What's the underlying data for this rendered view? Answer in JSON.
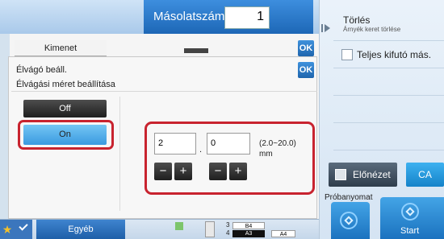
{
  "header": {
    "copies_label": "Másolatszám",
    "copies_value": "1"
  },
  "right_panel": {
    "torles_title": "Törlés",
    "torles_subtitle": "Árnyék keret törlése",
    "teljes_label": "Teljes kifutó más.",
    "elonezet_label": "Előnézet",
    "ca_label": "CA",
    "probanyomat_label": "Próbanyomat",
    "start_label": "Start"
  },
  "background": {
    "kimenet_tab": "Kimenet",
    "ok_label": "OK"
  },
  "dialog": {
    "title": "Élvágó beáll.",
    "subtitle": "Élvágási méret beállítása",
    "ok_label": "OK",
    "off_label": "Off",
    "on_label": "On",
    "value1": "2",
    "separator": ".",
    "value2": "0",
    "range": "(2.0~20.0)",
    "unit": "mm",
    "minus": "−",
    "plus": "+"
  },
  "bottom_bar": {
    "egyeb_label": "Egyéb",
    "tray_nums": [
      "3",
      "4"
    ],
    "tray_sizes": [
      "B4",
      "A3",
      "A4"
    ]
  },
  "colors": {
    "accent_blue": "#1f65ad",
    "highlight_red": "#c8232f",
    "selected_blue": "#3a9ae0"
  },
  "icons": [
    "star-icon",
    "check-icon",
    "play-icon",
    "preview-icon",
    "diamond-icon"
  ]
}
